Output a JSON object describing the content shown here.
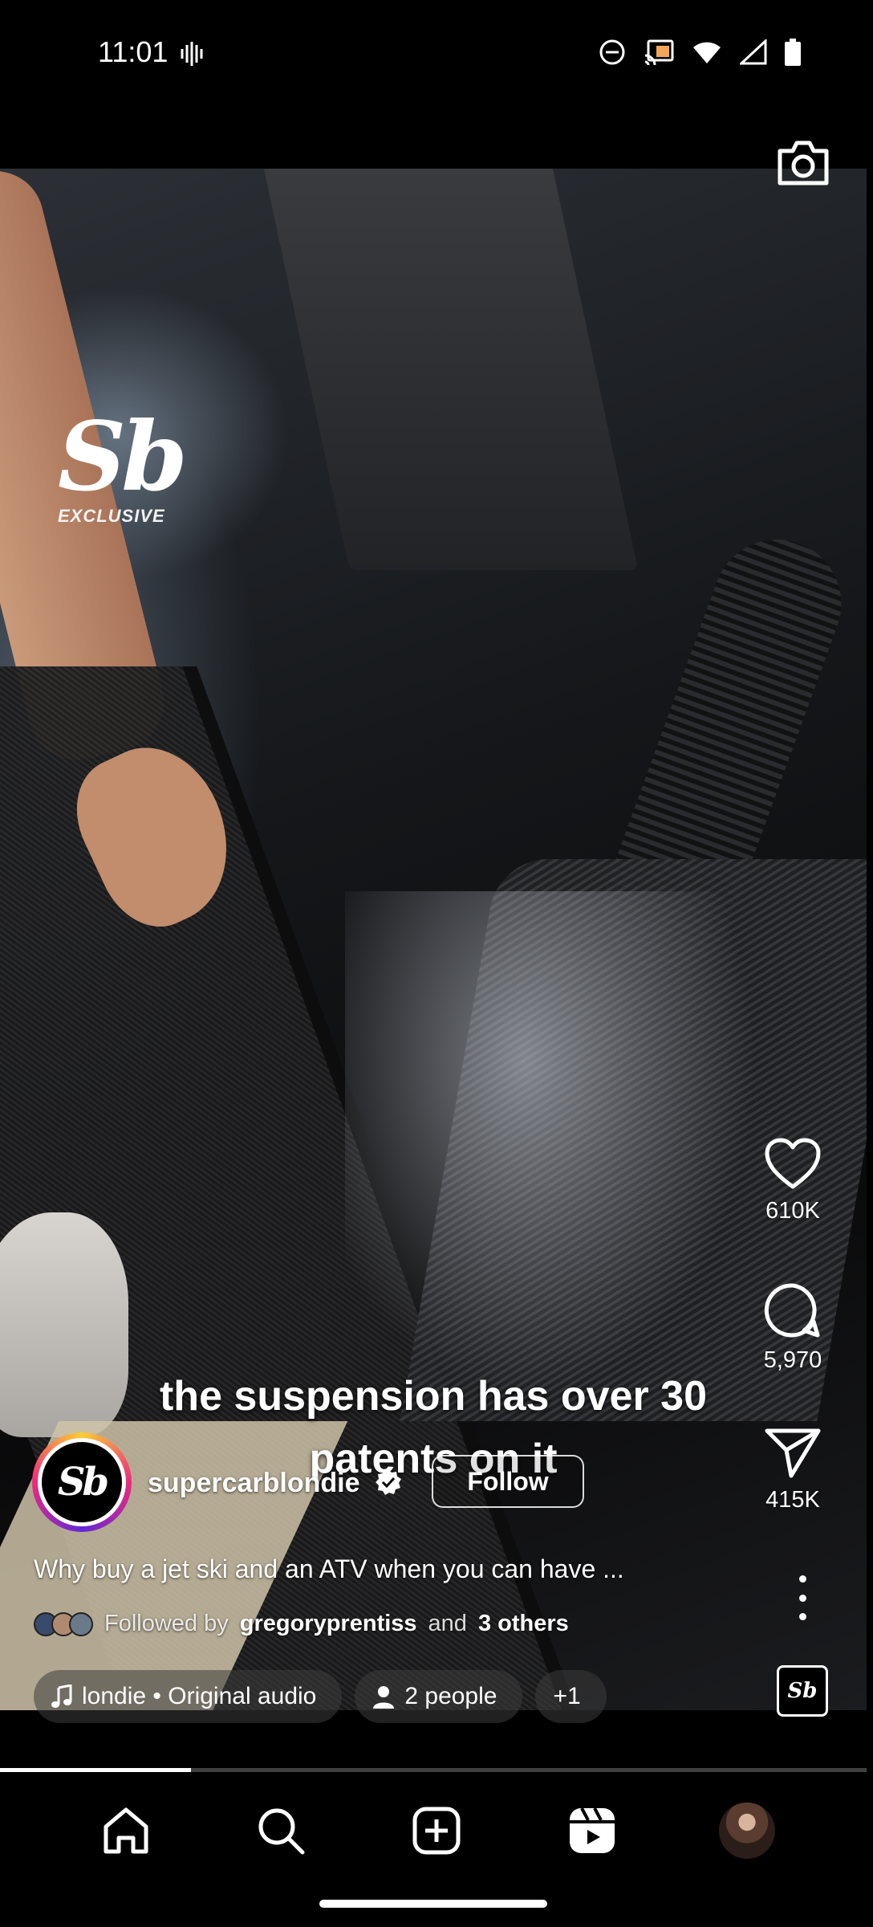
{
  "status_bar": {
    "time": "11:01"
  },
  "video": {
    "watermark_logo": "Sb",
    "watermark_label": "EXCLUSIVE",
    "caption_overlay": "the suspension has over 30 patents on it"
  },
  "rail": {
    "likes": "610K",
    "comments": "5,970",
    "shares": "415K"
  },
  "author": {
    "username": "supercarblondie",
    "avatar_initials": "Sb",
    "follow_label": "Follow"
  },
  "description": "Why buy a jet ski and an ATV when you can have ...",
  "followed_by": {
    "prefix": "Followed by",
    "user": "gregoryprentiss",
    "joiner": "and",
    "others": "3 others"
  },
  "pills": {
    "audio": "londie • Original audio",
    "people": "2 people",
    "more": "+1"
  },
  "audio_thumb": "Sb",
  "progress": 0.22,
  "icons": {
    "camera": "camera-icon",
    "like": "heart-icon",
    "comment": "comment-icon",
    "share": "send-icon",
    "more": "more-vertical-icon",
    "home": "home-icon",
    "search": "search-icon",
    "create": "add-square-icon",
    "reels": "reels-icon",
    "profile": "profile-avatar"
  }
}
